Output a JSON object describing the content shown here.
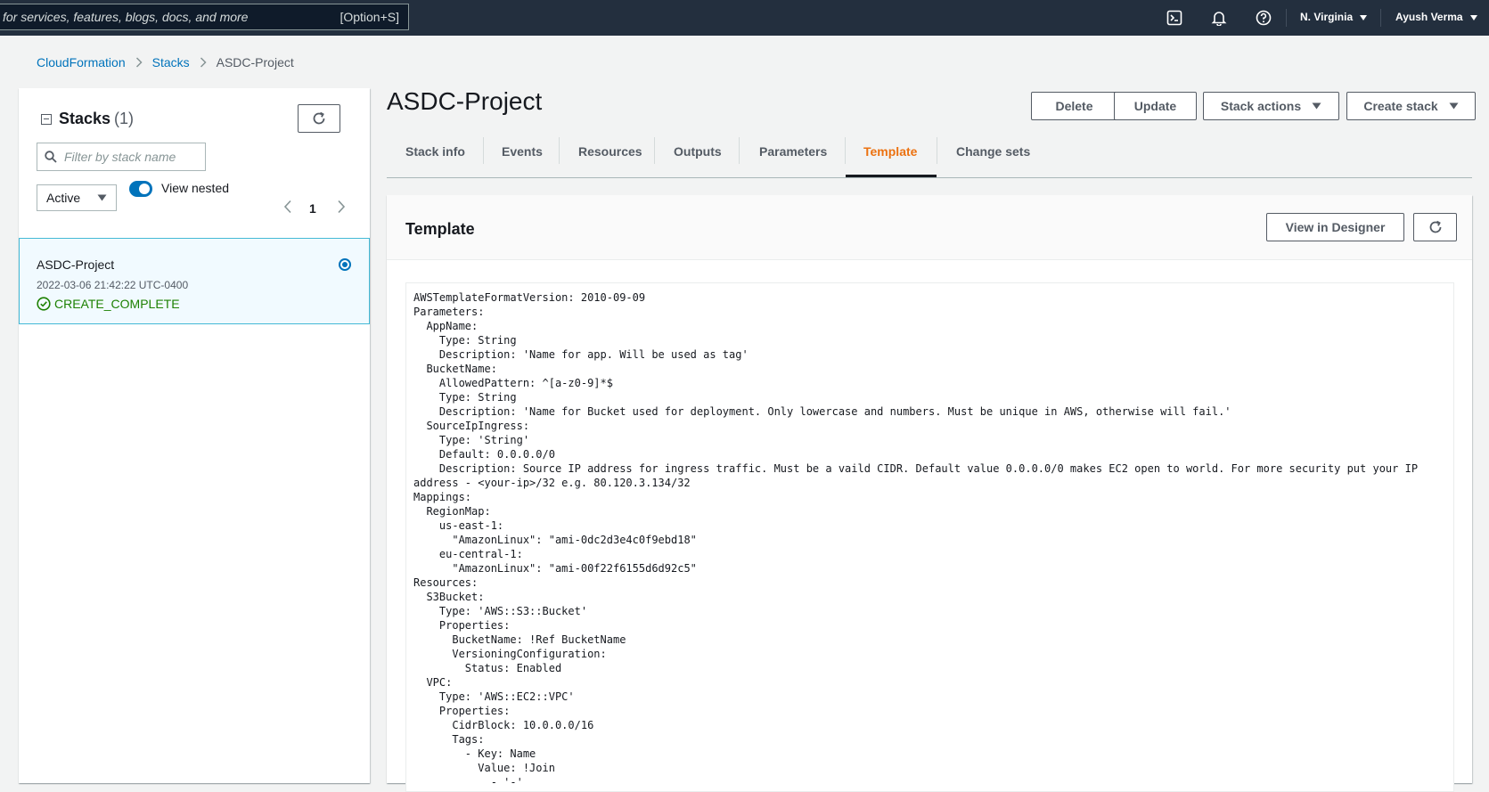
{
  "topnav": {
    "search_placeholder": "for services, features, blogs, docs, and more",
    "search_shortcut": "[Option+S]",
    "region": "N. Virginia",
    "user": "Ayush Verma",
    "icons": [
      "cloudshell-icon",
      "bell-icon",
      "help-icon"
    ]
  },
  "breadcrumb": {
    "items": [
      "CloudFormation",
      "Stacks"
    ],
    "current": "ASDC-Project"
  },
  "sidebar": {
    "title": "Stacks",
    "count": "(1)",
    "filter_placeholder": "Filter by stack name",
    "status_filter": "Active",
    "view_nested_label": "View nested",
    "view_nested_on": true,
    "page": "1",
    "stacks": [
      {
        "name": "ASDC-Project",
        "created": "2022-03-06 21:42:22 UTC-0400",
        "status": "CREATE_COMPLETE",
        "selected": true
      }
    ]
  },
  "main": {
    "title": "ASDC-Project",
    "buttons": {
      "delete": "Delete",
      "update": "Update",
      "stack_actions": "Stack actions",
      "create_stack": "Create stack"
    },
    "tabs": [
      {
        "label": "Stack info"
      },
      {
        "label": "Events"
      },
      {
        "label": "Resources"
      },
      {
        "label": "Outputs"
      },
      {
        "label": "Parameters"
      },
      {
        "label": "Template",
        "active": true
      },
      {
        "label": "Change sets"
      }
    ],
    "template": {
      "title": "Template",
      "view_in_designer": "View in Designer",
      "code": "AWSTemplateFormatVersion: 2010-09-09\nParameters:\n  AppName:\n    Type: String\n    Description: 'Name for app. Will be used as tag'\n  BucketName:\n    AllowedPattern: ^[a-z0-9]*$\n    Type: String\n    Description: 'Name for Bucket used for deployment. Only lowercase and numbers. Must be unique in AWS, otherwise will fail.'\n  SourceIpIngress:\n    Type: 'String'\n    Default: 0.0.0.0/0\n    Description: Source IP address for ingress traffic. Must be a vaild CIDR. Default value 0.0.0.0/0 makes EC2 open to world. For more security put your IP address - <your-ip>/32 e.g. 80.120.3.134/32\nMappings:\n  RegionMap:\n    us-east-1:\n      \"AmazonLinux\": \"ami-0dc2d3e4c0f9ebd18\"\n    eu-central-1:\n      \"AmazonLinux\": \"ami-00f22f6155d6d92c5\"\nResources:\n  S3Bucket:\n    Type: 'AWS::S3::Bucket'\n    Properties:\n      BucketName: !Ref BucketName\n      VersioningConfiguration:\n        Status: Enabled\n  VPC:\n    Type: 'AWS::EC2::VPC'\n    Properties:\n      CidrBlock: 10.0.0.0/16\n      Tags:\n        - Key: Name\n          Value: !Join\n            - '-'"
    }
  },
  "colors": {
    "accent": "#ec7211",
    "link": "#0073bb",
    "success": "#1d8102",
    "nav_bg": "#232f3e"
  }
}
